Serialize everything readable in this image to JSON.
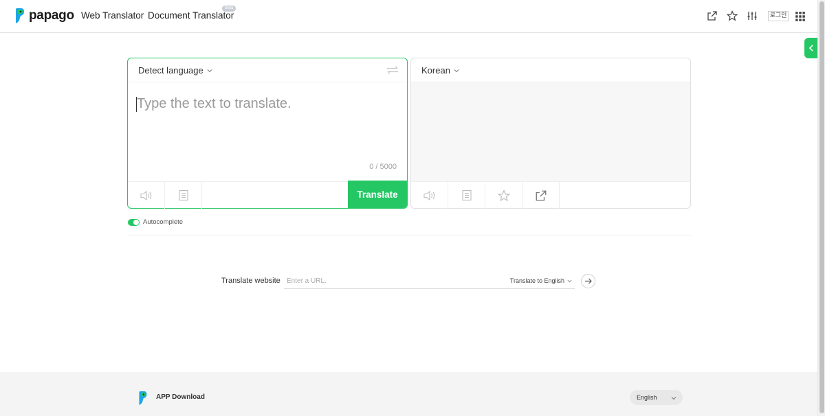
{
  "header": {
    "logo_text": "papago",
    "nav": {
      "web_translator": "Web Translator",
      "document_translator": "Document Translator",
      "beta_badge": "Beta"
    },
    "login_label": "로그인",
    "icons": [
      "share-icon",
      "star-icon",
      "sliders-icon",
      "apps-grid-icon"
    ]
  },
  "source": {
    "language": "Detect language",
    "placeholder": "Type the text to translate.",
    "counter": "0 / 5000",
    "translate_label": "Translate",
    "footer_icons": [
      "speaker-icon",
      "dictionary-icon"
    ]
  },
  "target": {
    "language": "Korean",
    "footer_icons": [
      "speaker-icon",
      "dictionary-icon",
      "star-icon",
      "share-icon"
    ]
  },
  "autocomplete": {
    "label": "Autocomplete",
    "enabled": true
  },
  "website": {
    "label": "Translate website",
    "url_placeholder": "Enter a URL.",
    "target_language": "Translate to English"
  },
  "footer": {
    "app_download": "APP Download",
    "site_language": "English"
  },
  "colors": {
    "accent": "#24c764",
    "panel_border": "#e0e0e0",
    "footer_bg": "#f4f4f4"
  }
}
